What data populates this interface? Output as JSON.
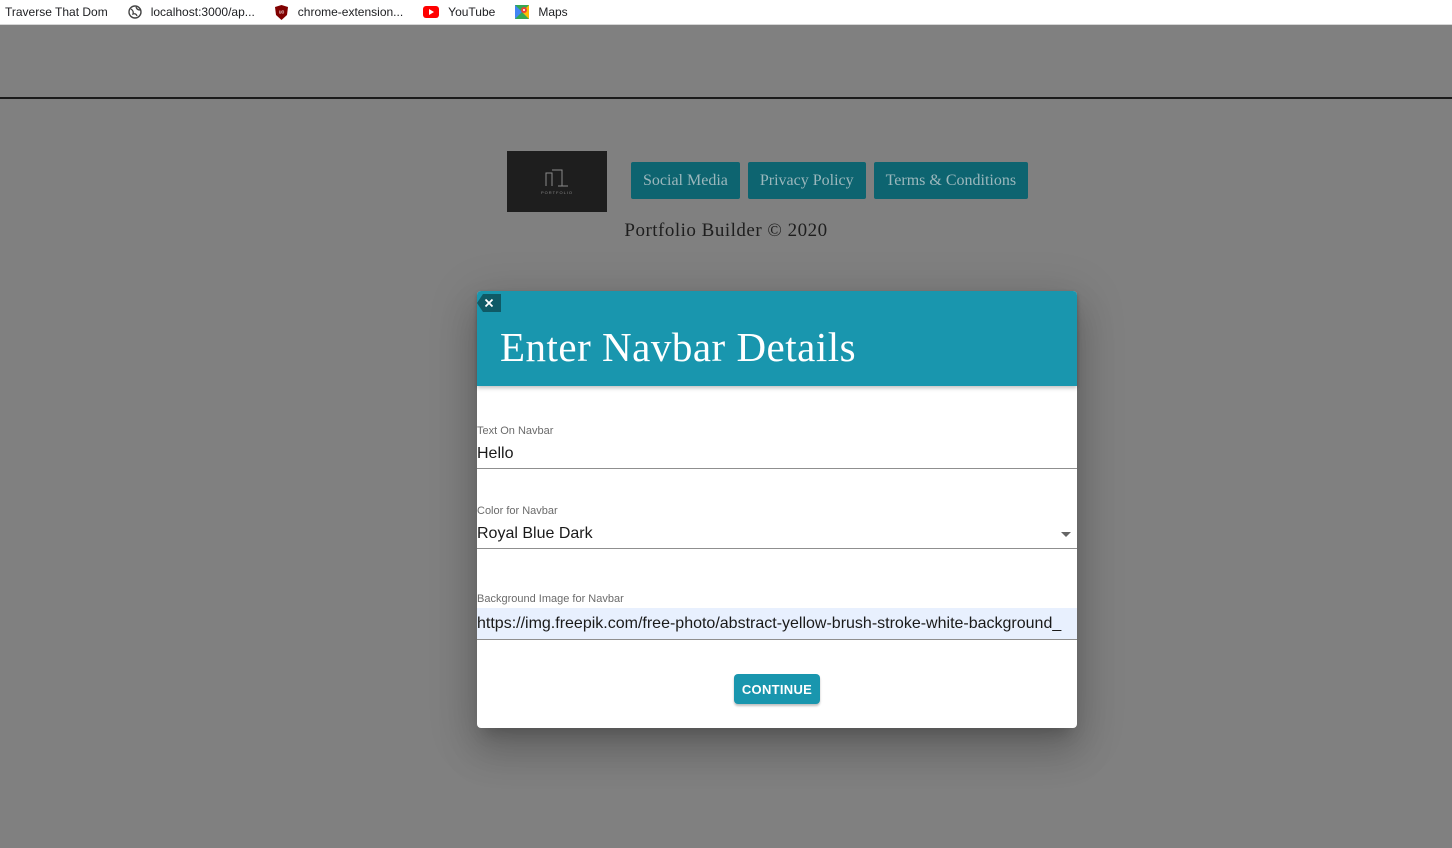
{
  "bookmarks": [
    {
      "label": "Traverse That Dom",
      "icon": "none"
    },
    {
      "label": "localhost:3000/ap...",
      "icon": "globe-icon"
    },
    {
      "label": "chrome-extension...",
      "icon": "ublock-shield-icon"
    },
    {
      "label": "YouTube",
      "icon": "youtube-icon"
    },
    {
      "label": "Maps",
      "icon": "maps-pin-icon"
    }
  ],
  "footer": {
    "logo_text": "PORTFOLIO",
    "links": [
      "Social Media",
      "Privacy Policy",
      "Terms & Conditions"
    ],
    "copyright": "Portfolio Builder © 2020"
  },
  "modal": {
    "title": "Enter Navbar Details",
    "close_icon": "close-icon",
    "fields": {
      "navbar_text": {
        "label": "Text On Navbar",
        "value": "Hello"
      },
      "navbar_color": {
        "label": "Color for Navbar",
        "value": "Royal Blue Dark"
      },
      "background_image": {
        "label": "Background Image for Navbar",
        "value": "https://img.freepik.com/free-photo/abstract-yellow-brush-stroke-white-background_"
      }
    },
    "continue_label": "CONTINUE"
  },
  "colors": {
    "overlay": "#808080",
    "modal_header": "#1996ae",
    "footer_button": "#0d6470",
    "autofill": "#e8f0fe"
  }
}
